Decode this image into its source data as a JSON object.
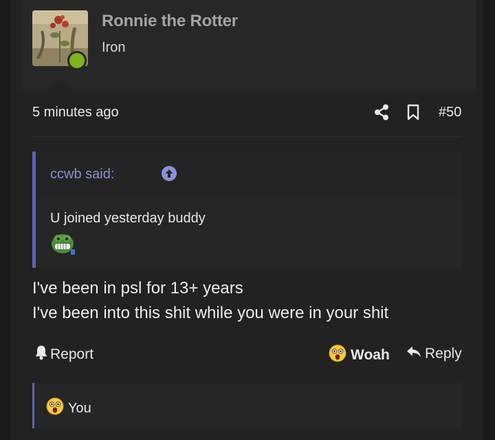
{
  "user": {
    "name": "Ronnie the Rotter",
    "title": "Iron",
    "status_color": "#7fb41d"
  },
  "post": {
    "time": "5 minutes ago",
    "number": "#50",
    "icons": [
      "share-icon",
      "bookmark-icon"
    ]
  },
  "quote": {
    "author": "ccwb said:",
    "text": "U joined yesterday buddy",
    "accent_color": "#5c64b8"
  },
  "message": {
    "line1": "I've been in psl for 13+ years",
    "line2": "I've been into this shit while you were in your shit"
  },
  "actions": {
    "report": "Report",
    "reaction": "Woah",
    "reply": "Reply"
  },
  "reactions": {
    "summary": "You"
  }
}
